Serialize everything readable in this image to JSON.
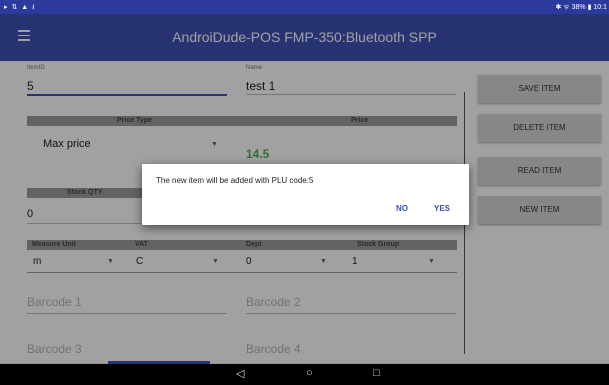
{
  "status_bar": {
    "left_icons": "▸ ⇅ ▲ ⭳",
    "right_text": "✱ ᯤ 38% ▮ 10:1"
  },
  "app_bar": {
    "menu_icon": "hamburger-menu-icon",
    "title": "AndroiDude-POS   FMP-350:Bluetooth SPP"
  },
  "form": {
    "item_id": {
      "label": "ItemID",
      "value": "5"
    },
    "name": {
      "label": "Name",
      "value": "test 1"
    },
    "price_type": {
      "header": "Price Type",
      "value": "Max price"
    },
    "price": {
      "header": "Price",
      "value": "14.5"
    },
    "stock_qty": {
      "header": "Stock QTY",
      "value": "0"
    },
    "measure_unit": {
      "header": "Measure Unit",
      "value": "m"
    },
    "vat": {
      "header": "VAT",
      "value": "C"
    },
    "dept": {
      "header": "Dept",
      "value": "0"
    },
    "stock_group": {
      "header": "Stock Group",
      "value": "1"
    },
    "barcode1": {
      "placeholder": "Barcode 1"
    },
    "barcode2": {
      "placeholder": "Barcode 2"
    },
    "barcode3": {
      "placeholder": "Barcode 3"
    },
    "barcode4": {
      "placeholder": "Barcode 4"
    }
  },
  "buttons": {
    "save": "SAVE ITEM",
    "delete": "DELETE ITEM",
    "read": "READ ITEM",
    "new": "NEW ITEM"
  },
  "dialog": {
    "message": "The new item will be added with PLU code:5",
    "no": "NO",
    "yes": "YES"
  },
  "nav_bar": {
    "back": "◁",
    "home": "○",
    "recents": "□"
  },
  "colors": {
    "primary": "#3f51b5",
    "status_bar": "#2c3a9c",
    "price_green": "#4caf50",
    "button_gray": "#d6d6d6"
  }
}
